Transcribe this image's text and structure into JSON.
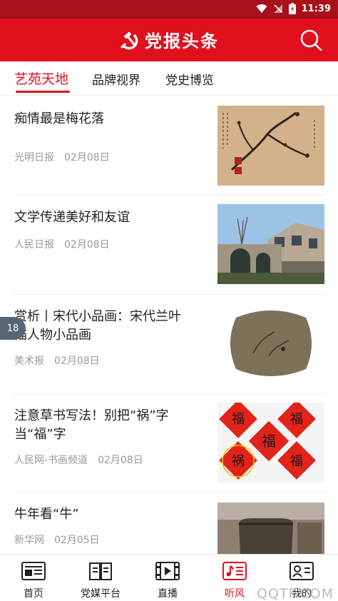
{
  "status_bar": {
    "time": "11:39"
  },
  "app": {
    "title": "党报头条"
  },
  "tabs": [
    {
      "label": "艺苑天地",
      "active": true
    },
    {
      "label": "品牌视界",
      "active": false
    },
    {
      "label": "党史博览",
      "active": false
    }
  ],
  "articles": [
    {
      "title": "痴情最是梅花落",
      "source": "光明日报",
      "date": "02月08日"
    },
    {
      "title": "文学传递美好和友谊",
      "source": "人民日报",
      "date": "02月08日"
    },
    {
      "title": "赏析丨宋代小品画：宋代兰叶描人物小品画",
      "source": "美术报",
      "date": "02月08日"
    },
    {
      "title": "注意草书写法！别把“祸”字当“福”字",
      "source": "人民网-书画频道",
      "date": "02月08日"
    },
    {
      "title": "牛年看“牛”",
      "source": "新华网",
      "date": "02月05日"
    }
  ],
  "float_badge": "18",
  "bottom_nav": [
    {
      "label": "首页",
      "icon": "newspaper-icon",
      "active": false
    },
    {
      "label": "党媒平台",
      "icon": "book-icon",
      "active": false
    },
    {
      "label": "直播",
      "icon": "film-icon",
      "active": false
    },
    {
      "label": "听风",
      "icon": "music-list-icon",
      "active": true
    },
    {
      "label": "我的",
      "icon": "profile-card-icon",
      "active": false
    }
  ],
  "watermark": "QQTF.COM",
  "colors": {
    "brand_red": "#e0101d",
    "status_red": "#a8111b"
  }
}
